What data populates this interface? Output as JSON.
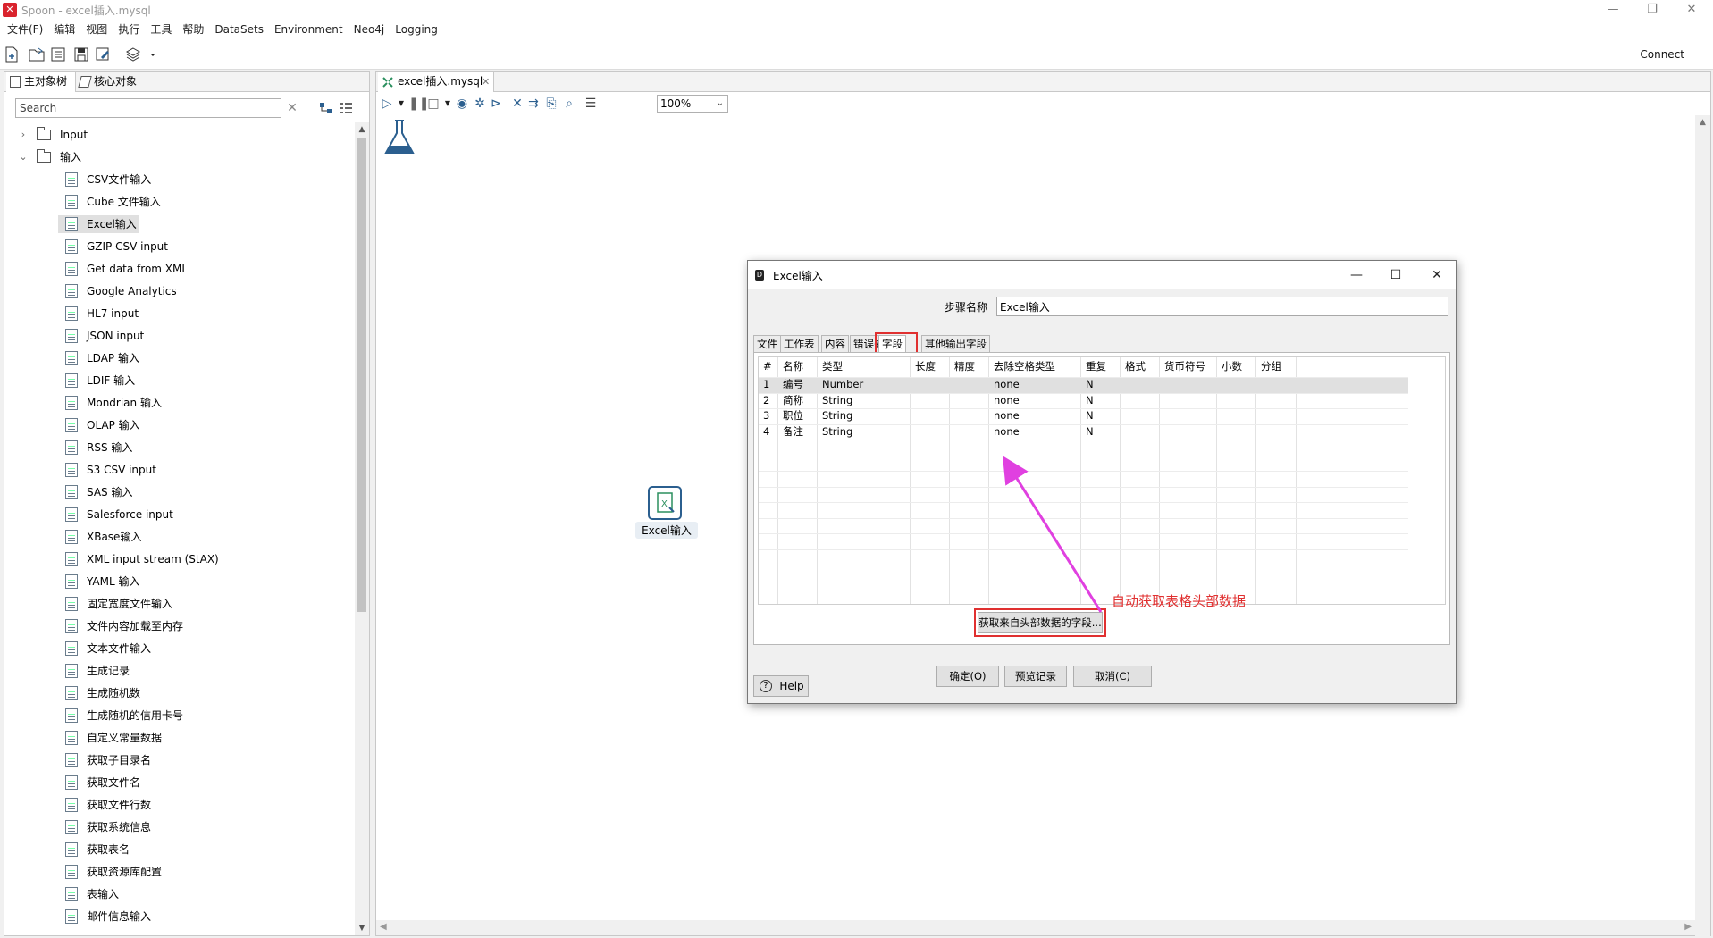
{
  "window": {
    "title": "Spoon - excel插入.mysql"
  },
  "menu": [
    "文件(F)",
    "编辑",
    "视图",
    "执行",
    "工具",
    "帮助",
    "DataSets",
    "Environment",
    "Neo4j",
    "Logging"
  ],
  "toolbar": {
    "connect_label": "Connect"
  },
  "left_panel": {
    "tab_main": "主对象树",
    "tab_core": "核心对象",
    "search_placeholder": "Search",
    "folders": [
      {
        "label": "Input",
        "expanded": false
      },
      {
        "label": "输入",
        "expanded": true
      }
    ],
    "steps": [
      "CSV文件输入",
      "Cube 文件输入",
      "Excel输入",
      "GZIP CSV input",
      "Get data from XML",
      "Google Analytics",
      "HL7 input",
      "JSON input",
      "LDAP 输入",
      "LDIF 输入",
      "Mondrian 输入",
      "OLAP 输入",
      "RSS 输入",
      "S3 CSV input",
      "SAS 输入",
      "Salesforce input",
      "XBase输入",
      "XML input stream (StAX)",
      "YAML 输入",
      "固定宽度文件输入",
      "文件内容加载至内存",
      "文本文件输入",
      "生成记录",
      "生成随机数",
      "生成随机的信用卡号",
      "自定义常量数据",
      "获取子目录名",
      "获取文件名",
      "获取文件行数",
      "获取系统信息",
      "获取表名",
      "获取资源库配置",
      "表输入",
      "邮件信息输入"
    ],
    "selected_step": "Excel输入"
  },
  "editor": {
    "tab_label": "excel插入.mysql",
    "zoom": "100%",
    "canvas_step_label": "Excel输入"
  },
  "dialog": {
    "title": "Excel输入",
    "stepname_label": "步骤名称",
    "stepname_value": "Excel输入",
    "tabs": [
      "文件",
      "工作表",
      "内容",
      "错误处理",
      "字段",
      "其他输出字段"
    ],
    "active_tab": "字段",
    "columns": [
      "#",
      "名称",
      "类型",
      "长度",
      "精度",
      "去除空格类型",
      "重复",
      "格式",
      "货币符号",
      "小数",
      "分组"
    ],
    "rows": [
      [
        "1",
        "编号",
        "Number",
        "",
        "",
        "none",
        "N",
        "",
        "",
        "",
        ""
      ],
      [
        "2",
        "简称",
        "String",
        "",
        "",
        "none",
        "N",
        "",
        "",
        "",
        ""
      ],
      [
        "3",
        "职位",
        "String",
        "",
        "",
        "none",
        "N",
        "",
        "",
        "",
        ""
      ],
      [
        "4",
        "备注",
        "String",
        "",
        "",
        "none",
        "N",
        "",
        "",
        "",
        ""
      ]
    ],
    "get_fields_label": "获取来自头部数据的字段...",
    "ok_label": "确定(O)",
    "preview_label": "预览记录",
    "cancel_label": "取消(C)",
    "help_label": "Help"
  },
  "annotation": {
    "text": "自动获取表格头部数据",
    "color": "#e03030"
  },
  "colors": {
    "accent": "#2b5f8f",
    "highlight": "#e03030",
    "arrow": "#e040e0"
  }
}
